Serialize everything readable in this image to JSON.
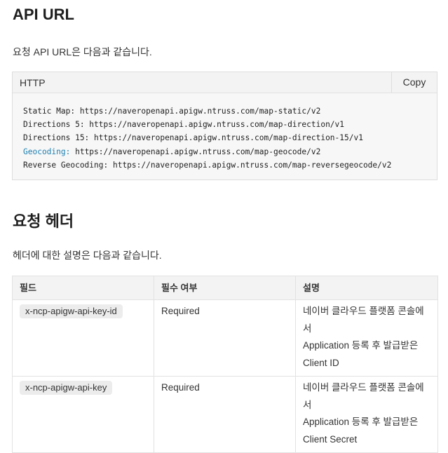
{
  "section1": {
    "title": "API URL",
    "intro": "요청 API URL은 다음과 같습니다.",
    "code": {
      "lang": "HTTP",
      "copy_label": "Copy",
      "lines": [
        "Static Map: https://naveropenapi.apigw.ntruss.com/map-static/v2",
        "Directions 5: https://naveropenapi.apigw.ntruss.com/map-direction/v1",
        "Directions 15: https://naveropenapi.apigw.ntruss.com/map-direction-15/v1",
        "Reverse Geocoding: https://naveropenapi.apigw.ntruss.com/map-reversegeocode/v2"
      ],
      "geocoding_label": "Geocoding:",
      "geocoding_url": " https://naveropenapi.apigw.ntruss.com/map-geocode/v2"
    }
  },
  "section2": {
    "title": "요청 헤더",
    "intro": "헤더에 대한 설명은 다음과 같습니다.",
    "table": {
      "headers": [
        "필드",
        "필수 여부",
        "설명"
      ],
      "rows": [
        {
          "field": "x-ncp-apigw-api-key-id",
          "required": "Required",
          "desc": [
            "네이버 클라우드 플랫폼 콘솔에서",
            "Application 등록 후 발급받은",
            "Client ID"
          ]
        },
        {
          "field": "x-ncp-apigw-api-key",
          "required": "Required",
          "desc": [
            "네이버 클라우드 플랫폼 콘솔에서",
            "Application 등록 후 발급받은",
            "Client Secret"
          ]
        }
      ]
    }
  }
}
